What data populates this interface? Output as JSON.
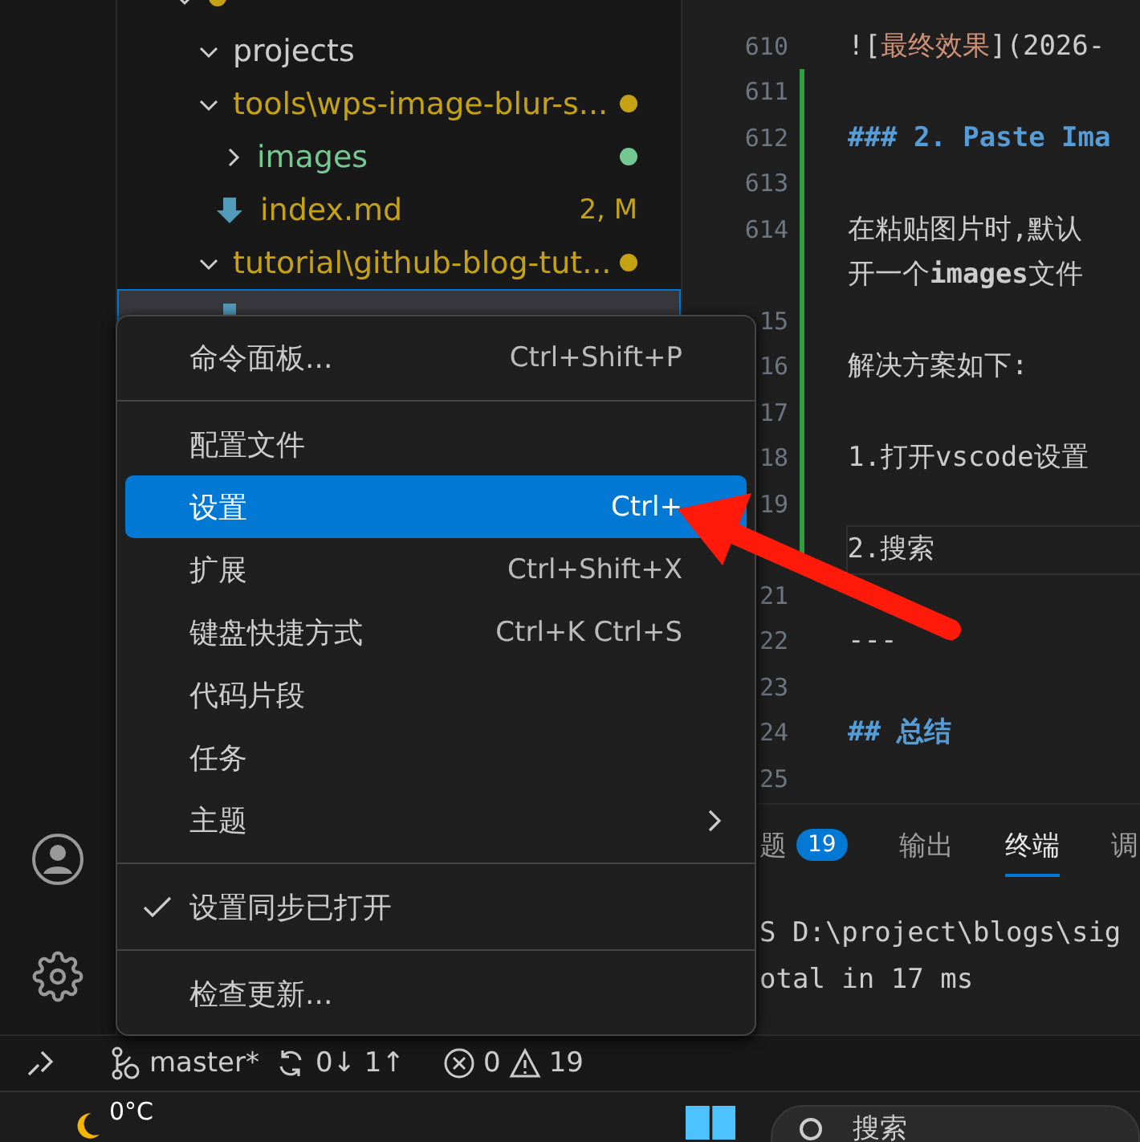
{
  "explorer": {
    "items": [
      {
        "kind": "folder",
        "expanded": true,
        "selected": false,
        "color": "#c5a214",
        "dot": true,
        "children": [
          {
            "label": "projects",
            "kind": "folder",
            "expanded": true,
            "selected": false,
            "color": "#cccccc",
            "dot": false
          },
          {
            "label": "tools\\wps-image-blur-s...",
            "kind": "folder",
            "expanded": true,
            "selected": false,
            "color": "#c5a214",
            "dot": true,
            "children": [
              {
                "label": "images",
                "kind": "folder",
                "expanded": false,
                "selected": false,
                "color": "#73c991",
                "dot": true
              },
              {
                "label": "index.md",
                "kind": "file",
                "selected": false,
                "color": "#c5a214",
                "decoration": "2, M"
              }
            ]
          },
          {
            "label": "tutorial\\github-blog-tut...",
            "kind": "folder",
            "expanded": true,
            "selected": false,
            "color": "#c5a214",
            "dot": true,
            "children": [
              {
                "kind": "file",
                "selected": true
              }
            ]
          }
        ]
      }
    ]
  },
  "editor": {
    "lines": [
      {
        "number": "610",
        "kind": "image",
        "text": "![**最终效果**](2026-"
      },
      {
        "number": "611"
      },
      {
        "number": "612",
        "kind": "heading",
        "text": "### 2. Paste Ima"
      },
      {
        "number": "613"
      },
      {
        "number": "614",
        "text": "在粘贴图片时,默认",
        "wrap": "开一个**images**文件"
      },
      {
        "number": "15"
      },
      {
        "number": "16",
        "text": "解决方案如下:"
      },
      {
        "number": "17"
      },
      {
        "number": "18",
        "text": "1.打开vscode设置"
      },
      {
        "number": "19"
      },
      {
        "text": "2.搜索",
        "current": true
      },
      {
        "number": "21"
      },
      {
        "number": "22",
        "text": "---"
      },
      {
        "number": "23"
      },
      {
        "number": "24",
        "kind": "heading",
        "text": "## 总结"
      },
      {
        "number": "25"
      }
    ]
  },
  "panel": {
    "tabs": [
      {
        "label": "题",
        "badge": "19",
        "selected": false
      },
      {
        "label": "输出",
        "selected": false
      },
      {
        "label": "终端",
        "selected": true
      },
      {
        "label": "调",
        "selected": false
      }
    ],
    "terminal": [
      "S D:\\project\\blogs\\sig",
      "otal in 17 ms"
    ]
  },
  "menu": {
    "groups": [
      [
        {
          "label": "命令面板...",
          "shortcut": "Ctrl+Shift+P",
          "selected": false
        }
      ],
      [
        {
          "label": "配置文件",
          "selected": false
        },
        {
          "label": "设置",
          "shortcut": "Ctrl+",
          "selected": true
        },
        {
          "label": "扩展",
          "shortcut": "Ctrl+Shift+X",
          "selected": false
        },
        {
          "label": "键盘快捷方式",
          "shortcut": "Ctrl+K Ctrl+S",
          "selected": false
        },
        {
          "label": "代码片段",
          "selected": false
        },
        {
          "label": "任务",
          "selected": false
        },
        {
          "label": "主题",
          "submenu": true,
          "selected": false
        }
      ],
      [
        {
          "label": "设置同步已打开",
          "checked": true,
          "selected": false
        }
      ],
      [
        {
          "label": "检查更新...",
          "selected": false
        }
      ]
    ]
  },
  "status_bar": {
    "branch": "master*",
    "sync": "0↓ 1↑",
    "errors": "0",
    "warnings": "19"
  },
  "taskbar": {
    "weather": "0°C",
    "search": "搜索"
  }
}
